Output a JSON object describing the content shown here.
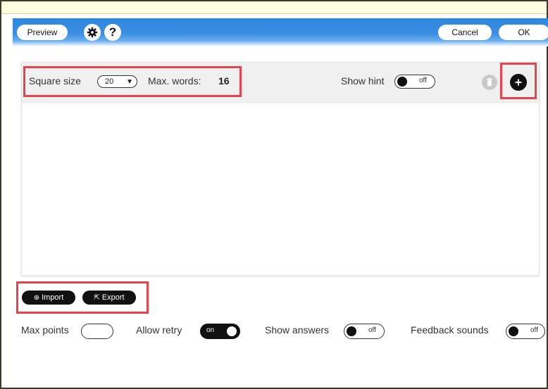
{
  "toolbar": {
    "preview_label": "Preview",
    "settings_icon": "gear-icon",
    "help_icon": "question-icon",
    "cancel_label": "Cancel",
    "ok_label": "OK"
  },
  "editor": {
    "square_size_label": "Square size",
    "square_size_value": "20",
    "max_words_label": "Max. words:",
    "max_words_value": "16",
    "show_hint_label": "Show hint",
    "show_hint_state": "off",
    "delete_icon": "trash-icon",
    "add_icon": "plus-icon"
  },
  "io": {
    "import_label": "Import",
    "export_label": "Export"
  },
  "settings": {
    "max_points_label": "Max points",
    "max_points_value": "",
    "allow_retry_label": "Allow retry",
    "allow_retry_state": "on",
    "show_answers_label": "Show answers",
    "show_answers_state": "off",
    "feedback_sounds_label": "Feedback sounds",
    "feedback_sounds_state": "off"
  },
  "colors": {
    "toolbar_blue": "#2e86dd",
    "highlight_red": "#e8434d",
    "dark_button": "#111111"
  }
}
